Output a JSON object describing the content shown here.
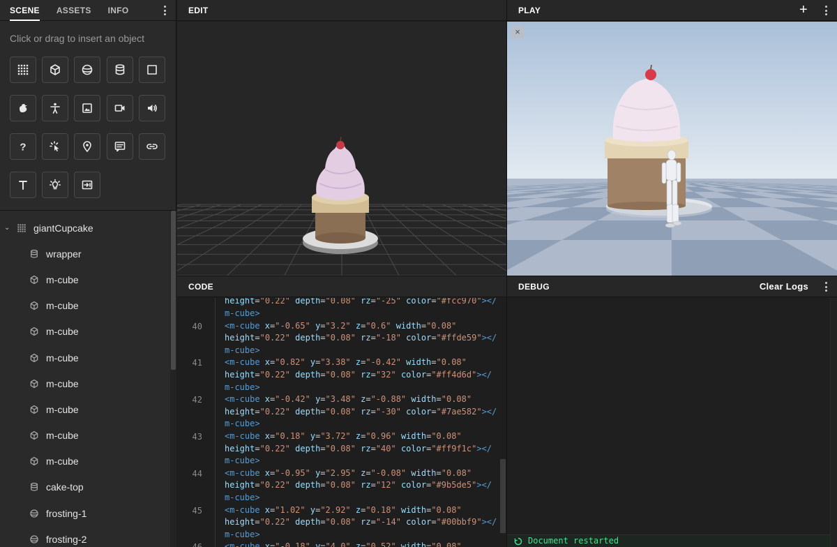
{
  "left_panel": {
    "tabs": [
      {
        "label": "SCENE",
        "active": true
      },
      {
        "label": "ASSETS",
        "active": false
      },
      {
        "label": "INFO",
        "active": false
      }
    ],
    "hint": "Click or drag to insert an object",
    "palette_icons": [
      "group-icon",
      "cube-icon",
      "sphere-icon",
      "cylinder-icon",
      "plane-icon",
      "model-icon",
      "character-icon",
      "image-icon",
      "video-icon",
      "audio-icon",
      "question-icon",
      "interaction-icon",
      "position-probe-icon",
      "label-icon",
      "link-icon",
      "text-icon",
      "light-icon",
      "prompt-icon"
    ],
    "tree": {
      "root": {
        "label": "giantCupcake",
        "icon": "group-icon"
      },
      "children": [
        {
          "label": "wrapper",
          "icon": "cylinder-icon"
        },
        {
          "label": "m-cube",
          "icon": "cube-icon"
        },
        {
          "label": "m-cube",
          "icon": "cube-icon"
        },
        {
          "label": "m-cube",
          "icon": "cube-icon"
        },
        {
          "label": "m-cube",
          "icon": "cube-icon"
        },
        {
          "label": "m-cube",
          "icon": "cube-icon"
        },
        {
          "label": "m-cube",
          "icon": "cube-icon"
        },
        {
          "label": "m-cube",
          "icon": "cube-icon"
        },
        {
          "label": "m-cube",
          "icon": "cube-icon"
        },
        {
          "label": "cake-top",
          "icon": "cylinder-icon"
        },
        {
          "label": "frosting-1",
          "icon": "sphere-icon"
        },
        {
          "label": "frosting-2",
          "icon": "sphere-icon"
        }
      ]
    }
  },
  "edit_panel": {
    "title": "EDIT"
  },
  "play_panel": {
    "title": "PLAY",
    "add_label": "+",
    "close_label": "×"
  },
  "code_panel": {
    "title": "CODE",
    "lines": [
      {
        "num": "",
        "parts": [
          [
            "at",
            "height"
          ],
          [
            "eq",
            "="
          ],
          [
            "st",
            "\"0.22\""
          ],
          [
            "at",
            " depth"
          ],
          [
            "eq",
            "="
          ],
          [
            "st",
            "\"0.08\""
          ],
          [
            "at",
            " rz"
          ],
          [
            "eq",
            "="
          ],
          [
            "st",
            "\"-25\""
          ],
          [
            "at",
            " color"
          ],
          [
            "eq",
            "="
          ],
          [
            "st",
            "\"#fcc970\""
          ],
          [
            "tg",
            "></"
          ]
        ]
      },
      {
        "num": "",
        "parts": [
          [
            "tg",
            "m-cube>"
          ]
        ]
      },
      {
        "num": "40",
        "parts": [
          [
            "tg",
            "<m-cube"
          ],
          [
            "at",
            " x"
          ],
          [
            "eq",
            "="
          ],
          [
            "st",
            "\"-0.65\""
          ],
          [
            "at",
            " y"
          ],
          [
            "eq",
            "="
          ],
          [
            "st",
            "\"3.2\""
          ],
          [
            "at",
            " z"
          ],
          [
            "eq",
            "="
          ],
          [
            "st",
            "\"0.6\""
          ],
          [
            "at",
            " width"
          ],
          [
            "eq",
            "="
          ],
          [
            "st",
            "\"0.08\""
          ]
        ]
      },
      {
        "num": "",
        "parts": [
          [
            "at",
            "height"
          ],
          [
            "eq",
            "="
          ],
          [
            "st",
            "\"0.22\""
          ],
          [
            "at",
            " depth"
          ],
          [
            "eq",
            "="
          ],
          [
            "st",
            "\"0.08\""
          ],
          [
            "at",
            " rz"
          ],
          [
            "eq",
            "="
          ],
          [
            "st",
            "\"-18\""
          ],
          [
            "at",
            " color"
          ],
          [
            "eq",
            "="
          ],
          [
            "st",
            "\"#ffde59\""
          ],
          [
            "tg",
            "></"
          ]
        ]
      },
      {
        "num": "",
        "parts": [
          [
            "tg",
            "m-cube>"
          ]
        ]
      },
      {
        "num": "41",
        "parts": [
          [
            "tg",
            "<m-cube"
          ],
          [
            "at",
            " x"
          ],
          [
            "eq",
            "="
          ],
          [
            "st",
            "\"0.82\""
          ],
          [
            "at",
            " y"
          ],
          [
            "eq",
            "="
          ],
          [
            "st",
            "\"3.38\""
          ],
          [
            "at",
            " z"
          ],
          [
            "eq",
            "="
          ],
          [
            "st",
            "\"-0.42\""
          ],
          [
            "at",
            " width"
          ],
          [
            "eq",
            "="
          ],
          [
            "st",
            "\"0.08\""
          ]
        ]
      },
      {
        "num": "",
        "parts": [
          [
            "at",
            "height"
          ],
          [
            "eq",
            "="
          ],
          [
            "st",
            "\"0.22\""
          ],
          [
            "at",
            " depth"
          ],
          [
            "eq",
            "="
          ],
          [
            "st",
            "\"0.08\""
          ],
          [
            "at",
            " rz"
          ],
          [
            "eq",
            "="
          ],
          [
            "st",
            "\"32\""
          ],
          [
            "at",
            " color"
          ],
          [
            "eq",
            "="
          ],
          [
            "st",
            "\"#ff4d6d\""
          ],
          [
            "tg",
            "></"
          ]
        ]
      },
      {
        "num": "",
        "parts": [
          [
            "tg",
            "m-cube>"
          ]
        ]
      },
      {
        "num": "42",
        "parts": [
          [
            "tg",
            "<m-cube"
          ],
          [
            "at",
            " x"
          ],
          [
            "eq",
            "="
          ],
          [
            "st",
            "\"-0.42\""
          ],
          [
            "at",
            " y"
          ],
          [
            "eq",
            "="
          ],
          [
            "st",
            "\"3.48\""
          ],
          [
            "at",
            " z"
          ],
          [
            "eq",
            "="
          ],
          [
            "st",
            "\"-0.88\""
          ],
          [
            "at",
            " width"
          ],
          [
            "eq",
            "="
          ],
          [
            "st",
            "\"0.08\""
          ]
        ]
      },
      {
        "num": "",
        "parts": [
          [
            "at",
            "height"
          ],
          [
            "eq",
            "="
          ],
          [
            "st",
            "\"0.22\""
          ],
          [
            "at",
            " depth"
          ],
          [
            "eq",
            "="
          ],
          [
            "st",
            "\"0.08\""
          ],
          [
            "at",
            " rz"
          ],
          [
            "eq",
            "="
          ],
          [
            "st",
            "\"-30\""
          ],
          [
            "at",
            " color"
          ],
          [
            "eq",
            "="
          ],
          [
            "st",
            "\"#7ae582\""
          ],
          [
            "tg",
            "></"
          ]
        ]
      },
      {
        "num": "",
        "parts": [
          [
            "tg",
            "m-cube>"
          ]
        ]
      },
      {
        "num": "43",
        "parts": [
          [
            "tg",
            "<m-cube"
          ],
          [
            "at",
            " x"
          ],
          [
            "eq",
            "="
          ],
          [
            "st",
            "\"0.18\""
          ],
          [
            "at",
            " y"
          ],
          [
            "eq",
            "="
          ],
          [
            "st",
            "\"3.72\""
          ],
          [
            "at",
            " z"
          ],
          [
            "eq",
            "="
          ],
          [
            "st",
            "\"0.96\""
          ],
          [
            "at",
            " width"
          ],
          [
            "eq",
            "="
          ],
          [
            "st",
            "\"0.08\""
          ]
        ]
      },
      {
        "num": "",
        "parts": [
          [
            "at",
            "height"
          ],
          [
            "eq",
            "="
          ],
          [
            "st",
            "\"0.22\""
          ],
          [
            "at",
            " depth"
          ],
          [
            "eq",
            "="
          ],
          [
            "st",
            "\"0.08\""
          ],
          [
            "at",
            " rz"
          ],
          [
            "eq",
            "="
          ],
          [
            "st",
            "\"40\""
          ],
          [
            "at",
            " color"
          ],
          [
            "eq",
            "="
          ],
          [
            "st",
            "\"#ff9f1c\""
          ],
          [
            "tg",
            "></"
          ]
        ]
      },
      {
        "num": "",
        "parts": [
          [
            "tg",
            "m-cube>"
          ]
        ]
      },
      {
        "num": "44",
        "parts": [
          [
            "tg",
            "<m-cube"
          ],
          [
            "at",
            " x"
          ],
          [
            "eq",
            "="
          ],
          [
            "st",
            "\"-0.95\""
          ],
          [
            "at",
            " y"
          ],
          [
            "eq",
            "="
          ],
          [
            "st",
            "\"2.95\""
          ],
          [
            "at",
            " z"
          ],
          [
            "eq",
            "="
          ],
          [
            "st",
            "\"-0.08\""
          ],
          [
            "at",
            " width"
          ],
          [
            "eq",
            "="
          ],
          [
            "st",
            "\"0.08\""
          ]
        ]
      },
      {
        "num": "",
        "parts": [
          [
            "at",
            "height"
          ],
          [
            "eq",
            "="
          ],
          [
            "st",
            "\"0.22\""
          ],
          [
            "at",
            " depth"
          ],
          [
            "eq",
            "="
          ],
          [
            "st",
            "\"0.08\""
          ],
          [
            "at",
            " rz"
          ],
          [
            "eq",
            "="
          ],
          [
            "st",
            "\"12\""
          ],
          [
            "at",
            " color"
          ],
          [
            "eq",
            "="
          ],
          [
            "st",
            "\"#9b5de5\""
          ],
          [
            "tg",
            "></"
          ]
        ]
      },
      {
        "num": "",
        "parts": [
          [
            "tg",
            "m-cube>"
          ]
        ]
      },
      {
        "num": "45",
        "parts": [
          [
            "tg",
            "<m-cube"
          ],
          [
            "at",
            " x"
          ],
          [
            "eq",
            "="
          ],
          [
            "st",
            "\"1.02\""
          ],
          [
            "at",
            " y"
          ],
          [
            "eq",
            "="
          ],
          [
            "st",
            "\"2.92\""
          ],
          [
            "at",
            " z"
          ],
          [
            "eq",
            "="
          ],
          [
            "st",
            "\"0.18\""
          ],
          [
            "at",
            " width"
          ],
          [
            "eq",
            "="
          ],
          [
            "st",
            "\"0.08\""
          ]
        ]
      },
      {
        "num": "",
        "parts": [
          [
            "at",
            "height"
          ],
          [
            "eq",
            "="
          ],
          [
            "st",
            "\"0.22\""
          ],
          [
            "at",
            " depth"
          ],
          [
            "eq",
            "="
          ],
          [
            "st",
            "\"0.08\""
          ],
          [
            "at",
            " rz"
          ],
          [
            "eq",
            "="
          ],
          [
            "st",
            "\"-14\""
          ],
          [
            "at",
            " color"
          ],
          [
            "eq",
            "="
          ],
          [
            "st",
            "\"#00bbf9\""
          ],
          [
            "tg",
            "></"
          ]
        ]
      },
      {
        "num": "",
        "parts": [
          [
            "tg",
            "m-cube>"
          ]
        ]
      },
      {
        "num": "46",
        "parts": [
          [
            "tg",
            "<m-cube"
          ],
          [
            "at",
            " x"
          ],
          [
            "eq",
            "="
          ],
          [
            "st",
            "\"-0.18\""
          ],
          [
            "at",
            " y"
          ],
          [
            "eq",
            "="
          ],
          [
            "st",
            "\"4.0\""
          ],
          [
            "at",
            " z"
          ],
          [
            "eq",
            "="
          ],
          [
            "st",
            "\"0.52\""
          ],
          [
            "at",
            " width"
          ],
          [
            "eq",
            "="
          ],
          [
            "st",
            "\"0.08\""
          ]
        ]
      }
    ]
  },
  "debug_panel": {
    "title": "DEBUG",
    "clear_label": "Clear Logs",
    "log": "Document restarted",
    "log_color": "#4ee08a"
  },
  "colors": {
    "panel_bg": "#2a2a2a",
    "header_bg": "#272727",
    "sky_top": "#a9bfd8",
    "frosting": "#e6d3e6",
    "cake_base": "#a08366",
    "cherry": "#d93a4a"
  }
}
